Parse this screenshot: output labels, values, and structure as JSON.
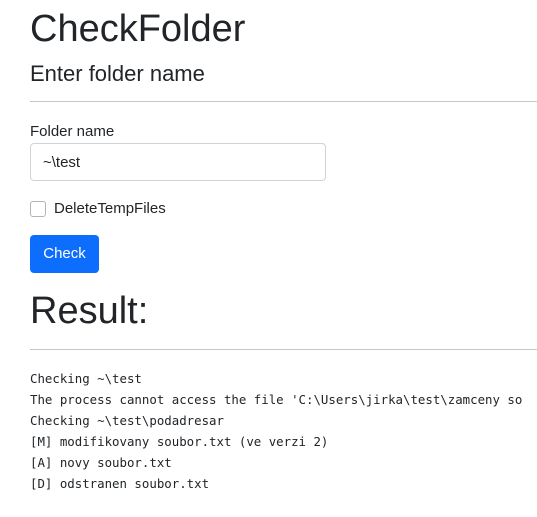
{
  "app": {
    "title": "CheckFolder",
    "subtitle": "Enter folder name"
  },
  "form": {
    "folder_label": "Folder name",
    "folder_value": "~\\test",
    "delete_temp_label": "DeleteTempFiles",
    "delete_temp_checked": false,
    "check_button_label": "Check"
  },
  "result": {
    "heading": "Result:",
    "lines": [
      "Checking ~\\test",
      "The process cannot access the file 'C:\\Users\\jirka\\test\\zamceny so",
      "Checking ~\\test\\podadresar",
      "[M] modifikovany soubor.txt (ve verzi 2)",
      "[A] novy soubor.txt",
      "[D] odstranen soubor.txt"
    ]
  },
  "colors": {
    "primary_button": "#0d6efd",
    "divider": "#c8c8c8",
    "text": "#212529"
  }
}
